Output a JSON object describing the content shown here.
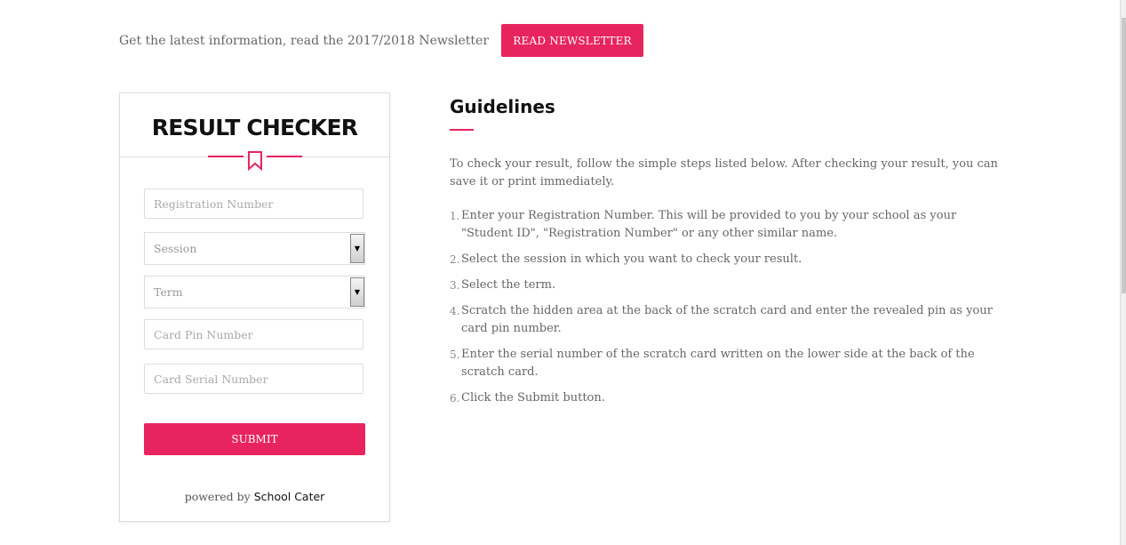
{
  "newsletter": {
    "text": "Get the latest information, read the 2017/2018 Newsletter",
    "button_label": "READ NEWSLETTER"
  },
  "result_checker": {
    "title": "RESULT CHECKER",
    "registration_placeholder": "Registration Number",
    "session_label": "Session",
    "term_label": "Term",
    "card_pin_placeholder": "Card Pin Number",
    "card_serial_placeholder": "Card Serial Number",
    "submit_label": "SUBMIT",
    "powered_by": "powered by",
    "brand": "School Cater"
  },
  "guidelines": {
    "title": "Guidelines",
    "intro": "To check your result, follow the simple steps listed below. After checking your result, you can save it or print immediately.",
    "steps": [
      {
        "num": "1.",
        "text": "Enter your Registration Number. This will be provided to you by your school as your \"Student ID\", \"Registration Number\" or any other similar name."
      },
      {
        "num": "2.",
        "text": "Select the session in which you want to check your result."
      },
      {
        "num": "3.",
        "text": "Select the term."
      },
      {
        "num": "4.",
        "text": "Scratch the hidden area at the back of the scratch card and enter the revealed pin as your card pin number."
      },
      {
        "num": "5.",
        "text": "Enter the serial number of the scratch card written on the lower side at the back of the scratch card."
      },
      {
        "num": "6.",
        "text": "Click the Submit button."
      }
    ]
  },
  "colors": {
    "accent": "#e8245f"
  }
}
